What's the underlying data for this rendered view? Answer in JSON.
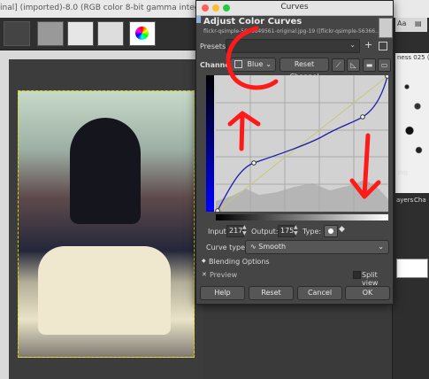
{
  "background": {
    "image_title": "inal] (imported)-8.0 (RGB color 8-bit gamma integer, GIM",
    "dock_labels": [
      "ness 025 (5",
      "ing",
      "ayers",
      "Cha"
    ]
  },
  "dialog": {
    "window_title": "Curves",
    "header_title": "Adjust Color Curves",
    "header_subtitle": "flickr-qsimple-5636649561-original.jpg-19 ([flickr-qsimple-56366...",
    "presets_label": "Presets:",
    "presets_value": "",
    "channel_label": "Channel",
    "channel_value": "Blue",
    "reset_channel_label": "Reset Channel",
    "input_label": "Input:",
    "input_value": "217",
    "output_label": "Output:",
    "output_value": "175",
    "type_label": "Type:",
    "curve_type_label": "Curve type:",
    "curve_type_value": "Smooth",
    "blending_label": "Blending Options",
    "preview_label": "Preview",
    "split_view_label": "Split view",
    "help_label": "Help",
    "reset_label": "Reset",
    "cancel_label": "Cancel",
    "ok_label": "OK"
  },
  "colors": {
    "curve": "#1c1ca8",
    "annotation": "#ff1a1a",
    "diagonal": "#c8c873"
  }
}
